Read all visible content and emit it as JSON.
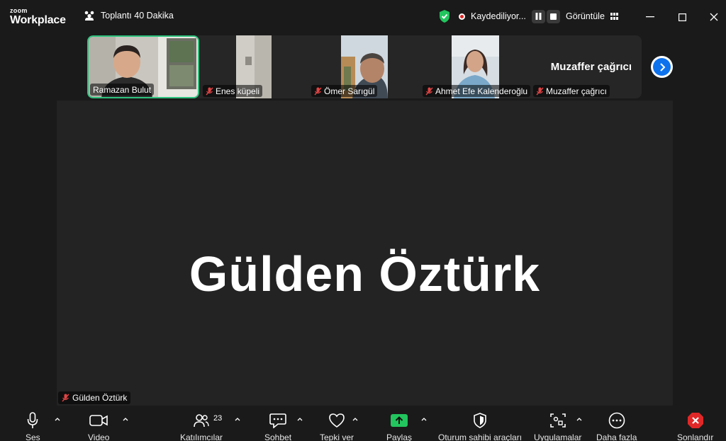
{
  "app": {
    "logo_line1": "zoom",
    "logo_line2": "Workplace"
  },
  "meeting": {
    "title": "Toplantı 40 Dakika"
  },
  "recording": {
    "status": "Kaydediliyor..."
  },
  "view": {
    "label": "Görüntüle"
  },
  "participants_strip": [
    {
      "name": "Ramazan Bulut",
      "muted": false,
      "active": true
    },
    {
      "name": "Enes küpeli",
      "muted": true,
      "active": false
    },
    {
      "name": "Ömer Sarıgül",
      "muted": true,
      "active": false
    },
    {
      "name": "Ahmet Efe Kalenderoğlu",
      "muted": true,
      "active": false
    },
    {
      "name": "Muzaffer çağrıcı",
      "muted": true,
      "active": false
    }
  ],
  "strip_overflow_name": "Muzaffer çağrıcı",
  "stage": {
    "name": "Gülden Öztürk",
    "label": "Gülden Öztürk"
  },
  "toolbar": {
    "audio": "Ses",
    "video": "Video",
    "participants": "Katılımcılar",
    "participants_count": "23",
    "chat": "Sohbet",
    "react": "Tepki ver",
    "share": "Paylaş",
    "host_tools": "Oturum sahibi araçları",
    "apps": "Uygulamalar",
    "more": "Daha fazla",
    "end": "Sonlandır"
  },
  "colors": {
    "active_border": "#2ec27e",
    "share_green": "#22c55e",
    "end_red": "#e02828",
    "accent_blue": "#0e72ed",
    "muted_red": "#e04444"
  }
}
